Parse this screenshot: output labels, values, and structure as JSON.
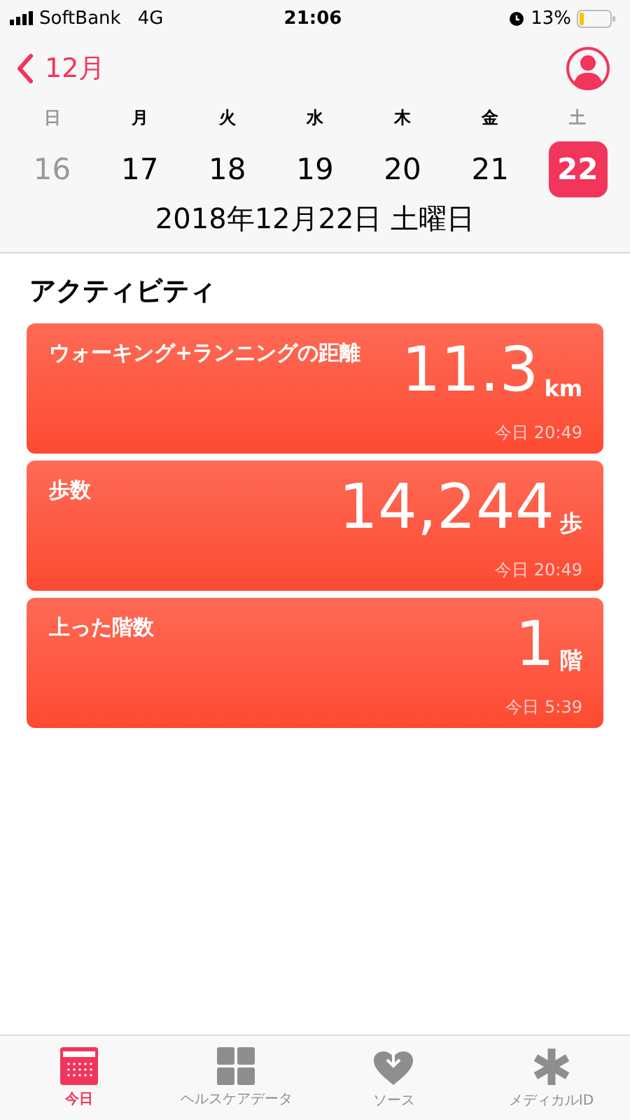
{
  "status_bar": {
    "carrier": "SoftBank",
    "network": "4G",
    "time": "21:06",
    "battery": "13%"
  },
  "nav": {
    "back": "12月"
  },
  "week": [
    {
      "weekday": "日",
      "date": "16",
      "weekend": true,
      "selected": false
    },
    {
      "weekday": "月",
      "date": "17",
      "weekend": false,
      "selected": false
    },
    {
      "weekday": "火",
      "date": "18",
      "weekend": false,
      "selected": false
    },
    {
      "weekday": "水",
      "date": "19",
      "weekend": false,
      "selected": false
    },
    {
      "weekday": "木",
      "date": "20",
      "weekend": false,
      "selected": false
    },
    {
      "weekday": "金",
      "date": "21",
      "weekend": false,
      "selected": false
    },
    {
      "weekday": "土",
      "date": "22",
      "weekend": true,
      "selected": true
    }
  ],
  "date_title": "2018年12月22日 土曜日",
  "section_title": "アクティビティ",
  "cards": [
    {
      "label": "ウォーキング+ランニングの距離",
      "value": "11.3",
      "unit": "km",
      "time": "今日 20:49"
    },
    {
      "label": "歩数",
      "value": "14,244",
      "unit": "歩",
      "time": "今日 20:49"
    },
    {
      "label": "上った階数",
      "value": "1",
      "unit": "階",
      "time": "今日 5:39"
    }
  ],
  "tabs": [
    {
      "label": "今日",
      "kind": "today",
      "selected": true
    },
    {
      "label": "ヘルスケアデータ",
      "kind": "grid",
      "selected": false
    },
    {
      "label": "ソース",
      "kind": "heart",
      "selected": false
    },
    {
      "label": "メディカルID",
      "kind": "asterisk",
      "selected": false
    }
  ]
}
